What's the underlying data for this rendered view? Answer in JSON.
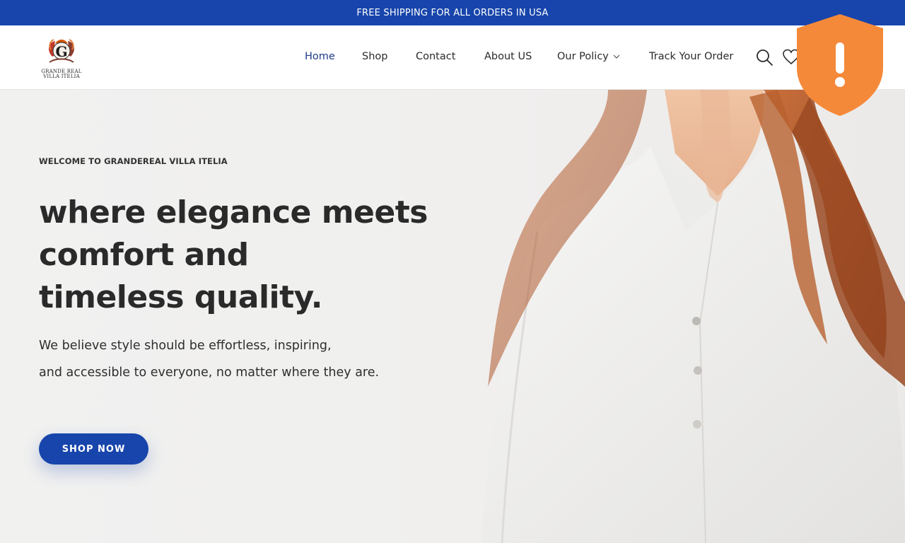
{
  "announcement": "FREE SHIPPING FOR ALL ORDERS IN USA",
  "brand": {
    "logo_line1": "GRANDE REAL",
    "logo_line2": "VILLA ITELIA"
  },
  "nav": {
    "items": [
      {
        "label": "Home",
        "active": true
      },
      {
        "label": "Shop"
      },
      {
        "label": "Contact"
      },
      {
        "label": "About US"
      },
      {
        "label": "Our Policy",
        "has_dropdown": true
      },
      {
        "label": "Track Your Order"
      }
    ]
  },
  "header_icons": [
    "search-icon",
    "heart-icon"
  ],
  "hero": {
    "eyebrow": "WELCOME TO GRANDEREAL VILLA ITELIA",
    "headline_lines": [
      "where elegance meets",
      "comfort and",
      "timeless quality."
    ],
    "subtext_lines": [
      "We believe style should be effortless, inspiring,",
      "and accessible to everyone, no matter where they are."
    ],
    "cta_label": "SHOP NOW"
  },
  "overlay": {
    "icon": "warning-shield-icon",
    "color": "#f5893a"
  },
  "colors": {
    "brand_blue": "#1745ab",
    "active_nav": "#1e3a8a",
    "text_dark": "#2a2a2a"
  }
}
